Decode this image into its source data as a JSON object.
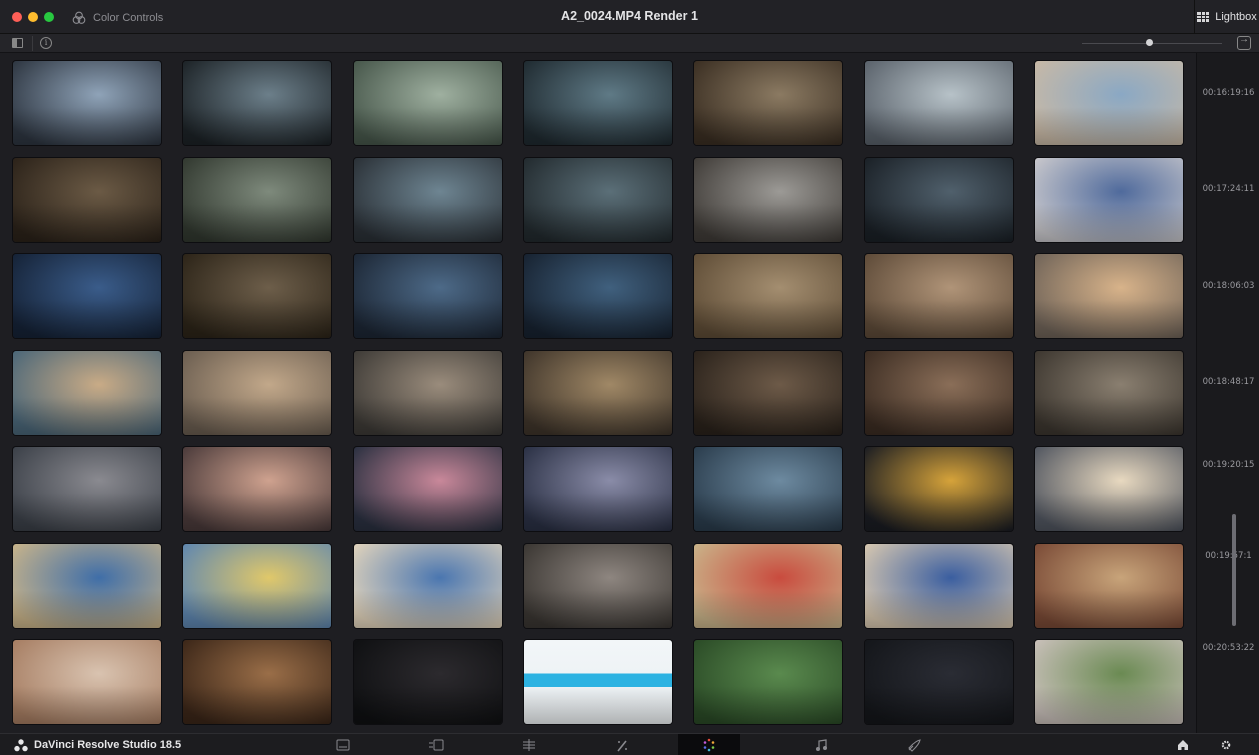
{
  "window": {
    "title": "A2_0024.MP4 Render 1",
    "color_controls_label": "Color Controls",
    "lightbox_label": "Lightbox"
  },
  "timecodes": [
    "00:16:19:16",
    "00:17:24:11",
    "00:18:06:03",
    "00:18:48:17",
    "00:19:20:15",
    "00:19:57:1",
    "00:20:53:22"
  ],
  "clips_per_row": 7,
  "clip_rows": 7,
  "app": {
    "name": "DaVinci Resolve Studio 18.5"
  },
  "pages": [
    {
      "name": "media",
      "icon": "media-page-icon",
      "active": false
    },
    {
      "name": "cut",
      "icon": "cut-page-icon",
      "active": false
    },
    {
      "name": "edit",
      "icon": "edit-page-icon",
      "active": false
    },
    {
      "name": "fusion",
      "icon": "fusion-page-icon",
      "active": false
    },
    {
      "name": "color",
      "icon": "color-page-icon",
      "active": true
    },
    {
      "name": "fairlight",
      "icon": "fairlight-page-icon",
      "active": false
    },
    {
      "name": "deliver",
      "icon": "deliver-page-icon",
      "active": false
    }
  ],
  "colors": {
    "accent": "#e64b3c",
    "background": "#1e1e22",
    "panel": "#222226"
  }
}
